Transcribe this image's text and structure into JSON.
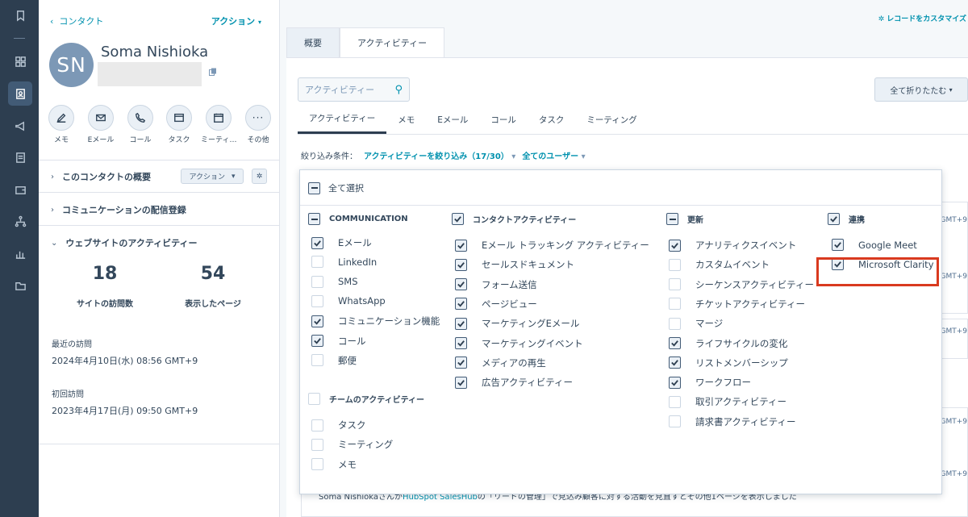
{
  "left": {
    "back_label": "コンタクト",
    "actions_label": "アクション",
    "avatar_initials": "SN",
    "contact_name": "Soma Nishioka",
    "quick_actions": [
      {
        "label": "メモ",
        "icon": "edit-icon"
      },
      {
        "label": "Eメール",
        "icon": "mail-icon"
      },
      {
        "label": "コール",
        "icon": "phone-icon"
      },
      {
        "label": "タスク",
        "icon": "task-icon"
      },
      {
        "label": "ミーティ…",
        "icon": "calendar-icon"
      },
      {
        "label": "その他",
        "icon": "more-icon"
      }
    ],
    "sections": {
      "overview": {
        "title": "このコンタクトの概要",
        "action_label": "アクション"
      },
      "subscriptions": {
        "title": "コミュニケーションの配信登録"
      },
      "website_activity": {
        "title": "ウェブサイトのアクティビティー"
      }
    },
    "stats": {
      "visits": {
        "value": "18",
        "label": "サイトの訪問数"
      },
      "pages": {
        "value": "54",
        "label": "表示したページ"
      }
    },
    "last_visit": {
      "label": "最近の訪問",
      "value": "2024年4月10日(水) 08:56 GMT+9"
    },
    "first_visit": {
      "label": "初回訪問",
      "value": "2023年4月17日(月) 09:50 GMT+9"
    }
  },
  "main": {
    "customize_label": "レコードをカスタマイズ",
    "tabs": [
      {
        "label": "概要"
      },
      {
        "label": "アクティビティー"
      }
    ],
    "search_placeholder": "アクティビティー",
    "collapse_label": "全て折りたたむ",
    "subtabs": [
      {
        "label": "アクティビティー"
      },
      {
        "label": "メモ"
      },
      {
        "label": "Eメール"
      },
      {
        "label": "コール"
      },
      {
        "label": "タスク"
      },
      {
        "label": "ミーティング"
      }
    ],
    "filter": {
      "label": "絞り込み条件：",
      "activity_filter": "アクティビティーを絞り込み（17/30）",
      "users_filter": "全てのユーザー"
    },
    "gmt_suffix": "GMT+9",
    "bottom_text_prefix": "Soma Nishiokaさんが",
    "bottom_text_link": "HubSpot SalesHub",
    "bottom_text_suffix": "の「リードの管理」で見込み顧客に対する活動を見直すとその他1ページを表示しました"
  },
  "dropdown": {
    "select_all_label": "全て選択",
    "columns": [
      {
        "header": "COMMUNICATION",
        "header_state": "indeterminate",
        "items": [
          {
            "label": "Eメール",
            "checked": true
          },
          {
            "label": "LinkedIn",
            "checked": false
          },
          {
            "label": "SMS",
            "checked": false
          },
          {
            "label": "WhatsApp",
            "checked": false
          },
          {
            "label": "コミュニケーション機能",
            "checked": true
          },
          {
            "label": "コール",
            "checked": true
          },
          {
            "label": "郵便",
            "checked": false
          }
        ]
      },
      {
        "header": "チームのアクティビティー",
        "header_state": "unchecked",
        "items": [
          {
            "label": "タスク",
            "checked": false
          },
          {
            "label": "ミーティング",
            "checked": false
          },
          {
            "label": "メモ",
            "checked": false
          }
        ]
      },
      {
        "header": "コンタクトアクティビティー",
        "header_state": "checked",
        "items": [
          {
            "label": "Eメール トラッキング アクティビティー",
            "checked": true
          },
          {
            "label": "セールスドキュメント",
            "checked": true
          },
          {
            "label": "フォーム送信",
            "checked": true
          },
          {
            "label": "ページビュー",
            "checked": true
          },
          {
            "label": "マーケティングEメール",
            "checked": true
          },
          {
            "label": "マーケティングイベント",
            "checked": true
          },
          {
            "label": "メディアの再生",
            "checked": true
          },
          {
            "label": "広告アクティビティー",
            "checked": true
          }
        ]
      },
      {
        "header": "更新",
        "header_state": "indeterminate",
        "items": [
          {
            "label": "アナリティクスイベント",
            "checked": true
          },
          {
            "label": "カスタムイベント",
            "checked": false
          },
          {
            "label": "シーケンスアクティビティー",
            "checked": false
          },
          {
            "label": "チケットアクティビティー",
            "checked": false
          },
          {
            "label": "マージ",
            "checked": false
          },
          {
            "label": "ライフサイクルの変化",
            "checked": true
          },
          {
            "label": "リストメンバーシップ",
            "checked": true
          },
          {
            "label": "ワークフロー",
            "checked": true
          },
          {
            "label": "取引アクティビティー",
            "checked": false
          },
          {
            "label": "請求書アクティビティー",
            "checked": false
          }
        ]
      },
      {
        "header": "連携",
        "header_state": "checked",
        "items": [
          {
            "label": "Google Meet",
            "checked": true
          },
          {
            "label": "Microsoft Clarity",
            "checked": true
          }
        ]
      }
    ]
  },
  "colors": {
    "accent": "#0091ae",
    "nav": "#2d3e50",
    "highlight": "#d93a1f"
  }
}
